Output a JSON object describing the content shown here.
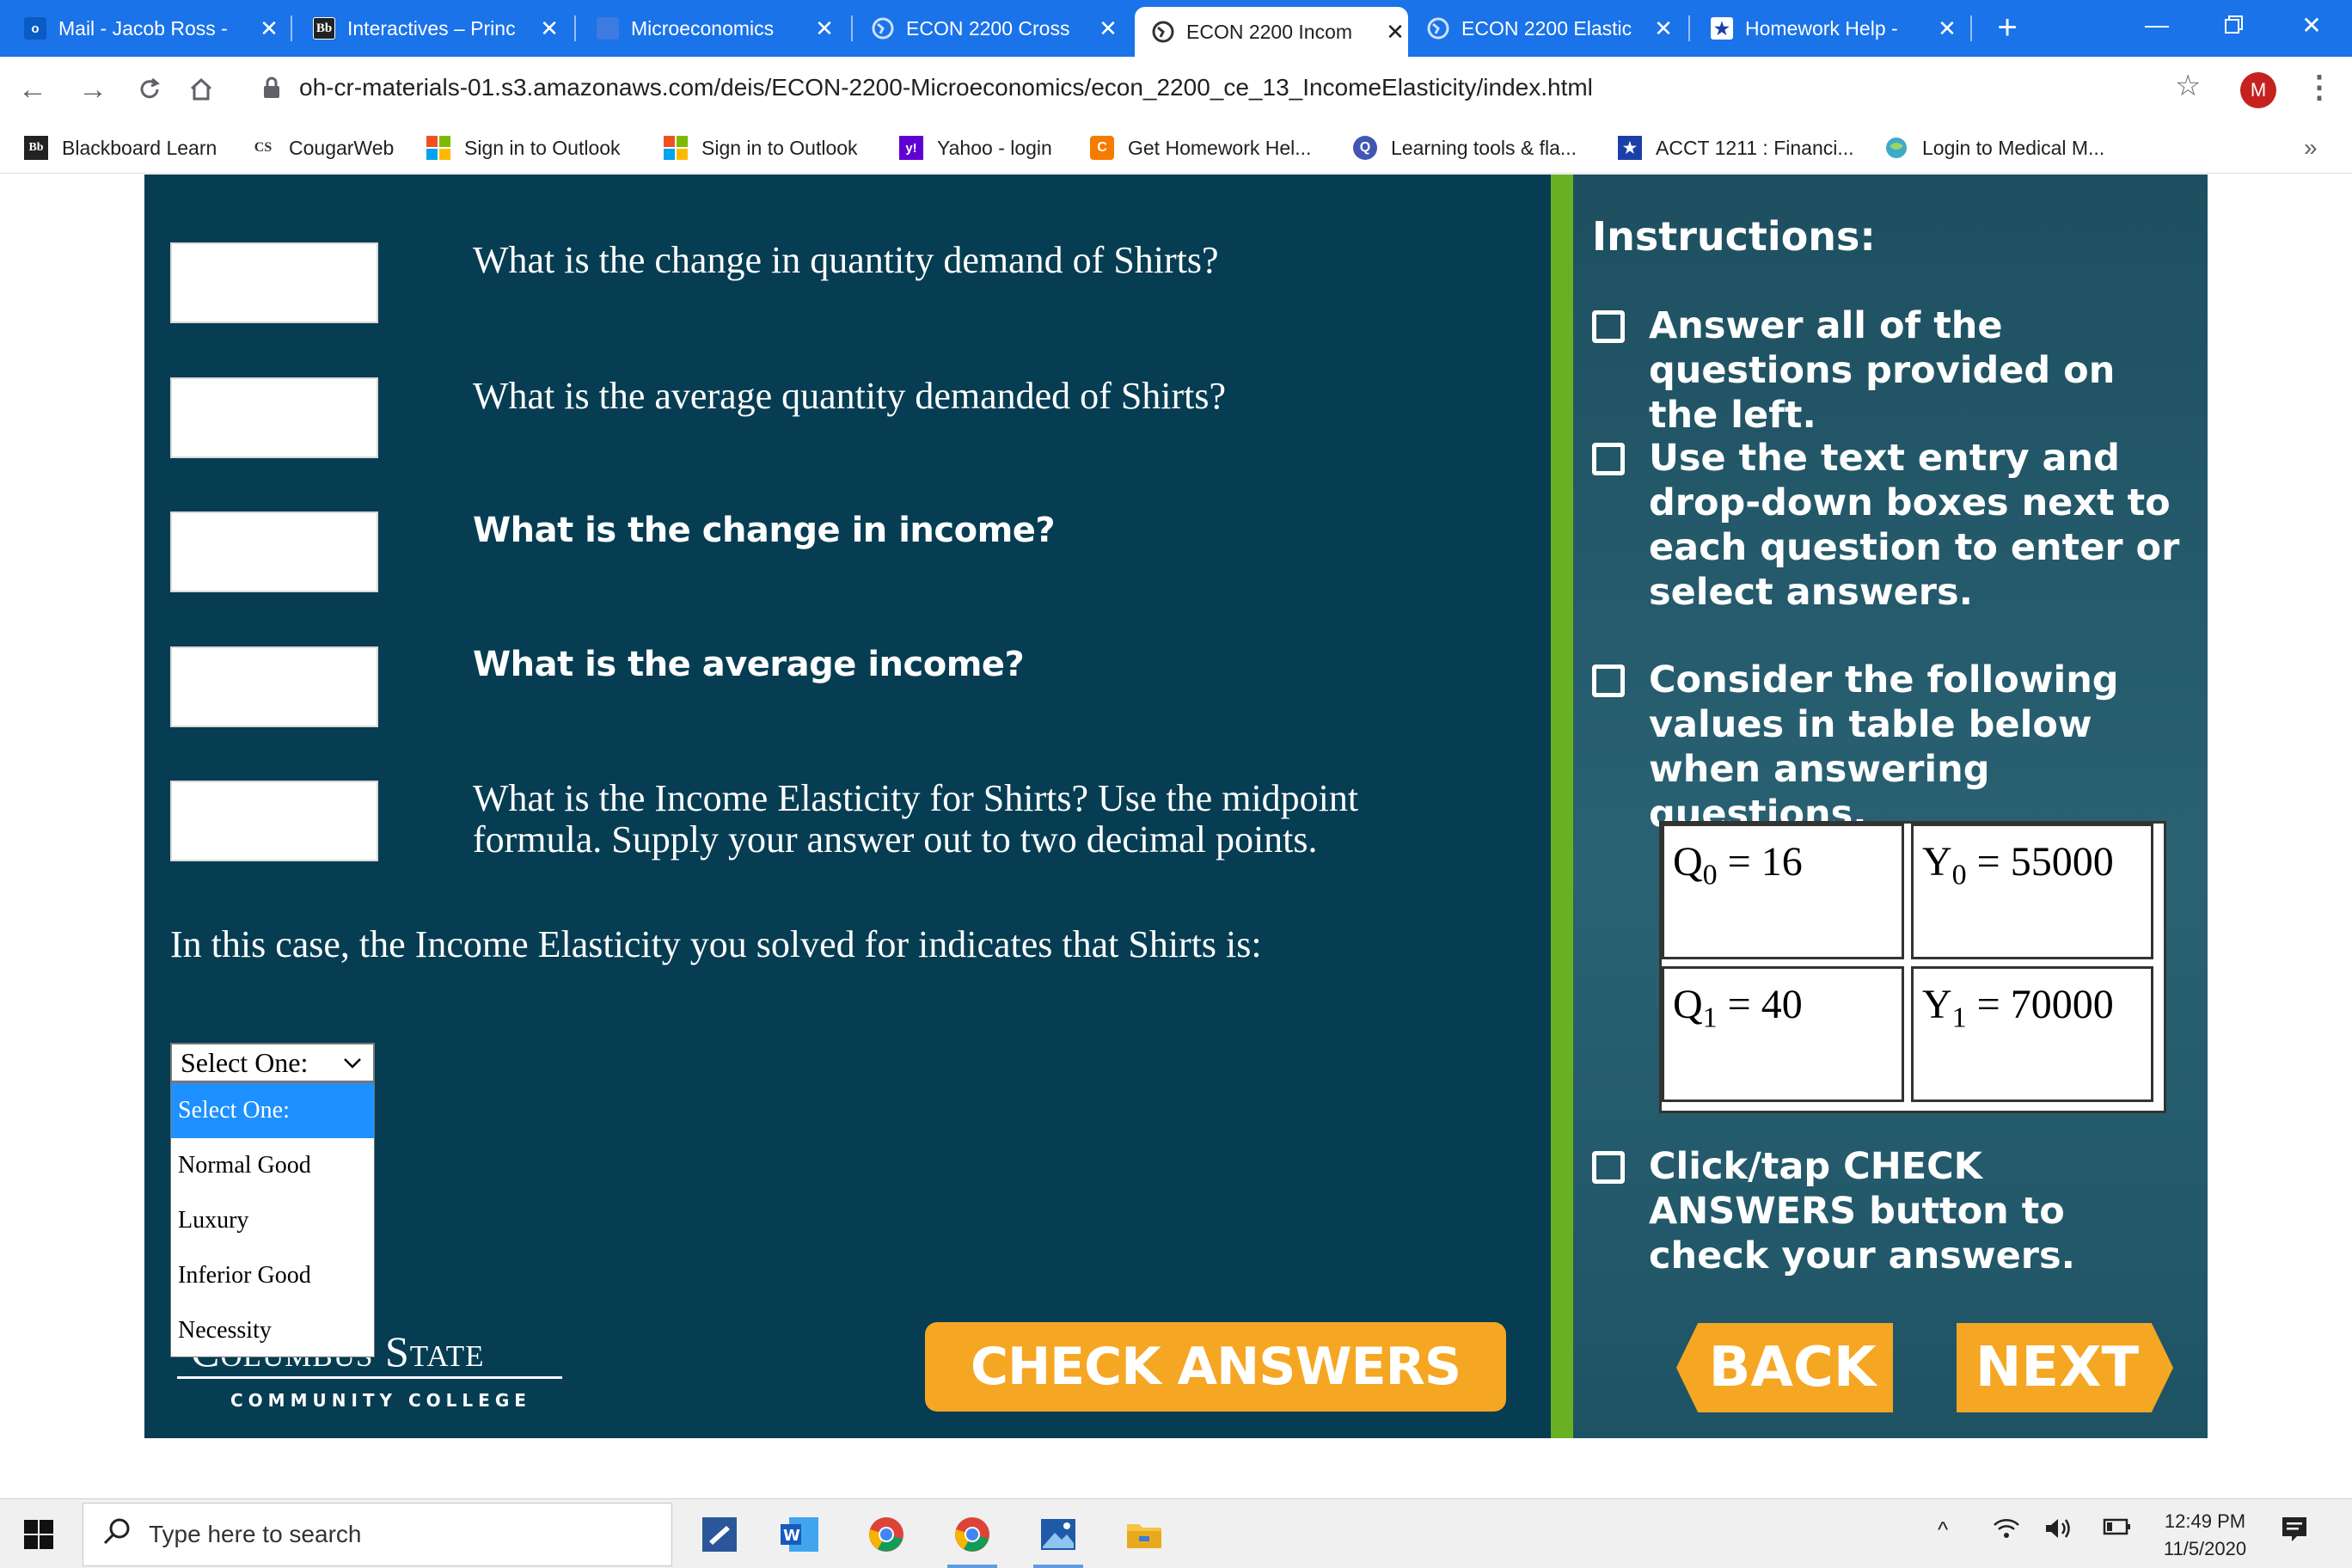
{
  "browser": {
    "tabs": [
      {
        "title": "Mail - Jacob Ross -",
        "icon": "outlook-icon"
      },
      {
        "title": "Interactives – Princ",
        "icon": "blackboard-icon"
      },
      {
        "title": "Microeconomics",
        "icon": "page-icon"
      },
      {
        "title": "ECON 2200 Cross",
        "icon": "globe-icon"
      },
      {
        "title": "ECON 2200 Incom",
        "icon": "globe-icon",
        "active": true
      },
      {
        "title": "ECON 2200 Elastic",
        "icon": "globe-icon"
      },
      {
        "title": "Homework Help -",
        "icon": "star-icon"
      }
    ],
    "url": "oh-cr-materials-01.s3.amazonaws.com/deis/ECON-2200-Microeconomics/econ_2200_ce_13_IncomeElasticity/index.html",
    "profile_initial": "M",
    "bookmarks": [
      {
        "label": "Blackboard Learn",
        "icon_text": "Bb"
      },
      {
        "label": "CougarWeb",
        "icon_text": "CS"
      },
      {
        "label": "Sign in to Outlook",
        "icon_text": ""
      },
      {
        "label": "Sign in to Outlook",
        "icon_text": ""
      },
      {
        "label": "Yahoo - login",
        "icon_text": "y!"
      },
      {
        "label": "Get Homework Hel...",
        "icon_text": "C"
      },
      {
        "label": "Learning tools & fla...",
        "icon_text": "Q"
      },
      {
        "label": "ACCT 1211 : Financi...",
        "icon_text": "★"
      },
      {
        "label": "Login to Medical M...",
        "icon_text": ""
      }
    ],
    "bookmarks_more": "»"
  },
  "activity": {
    "questions": [
      "What is the change in quantity demand of Shirts?",
      "What is the average quantity demanded of Shirts?",
      "What is the change in income?",
      "What is the average income?",
      "What is the Income Elasticity for Shirts? Use the midpoint formula. Supply your answer out to two decimal points."
    ],
    "case_text": "In this case, the Income Elasticity you solved for indicates that Shirts is:",
    "select_value": "Select One:",
    "options": [
      "Select One:",
      "Normal Good",
      "Luxury",
      "Inferior Good",
      "Necessity"
    ],
    "logo_main": "Columbus State",
    "logo_sub": "COMMUNITY COLLEGE",
    "check_label": "CHECK ANSWERS",
    "instructions_title": "Instructions:",
    "instructions": [
      "Answer all of the questions provided on the left.",
      "Use the text entry and drop-down boxes next to each question to enter or select answers.",
      "Consider the following values in table below when answering questions.",
      "Click/tap CHECK ANSWERS button to check your answers."
    ],
    "table": {
      "q0": {
        "sym": "Q",
        "sub": "0",
        "val": "= 16"
      },
      "y0": {
        "sym": "Y",
        "sub": "0",
        "val": "= 55000"
      },
      "q1": {
        "sym": "Q",
        "sub": "1",
        "val": "= 40"
      },
      "y1": {
        "sym": "Y",
        "sub": "1",
        "val": "= 70000"
      }
    },
    "back_label": "BACK",
    "next_label": "NEXT"
  },
  "taskbar": {
    "search_placeholder": "Type here to search",
    "time": "12:49 PM",
    "date": "11/5/2020"
  }
}
